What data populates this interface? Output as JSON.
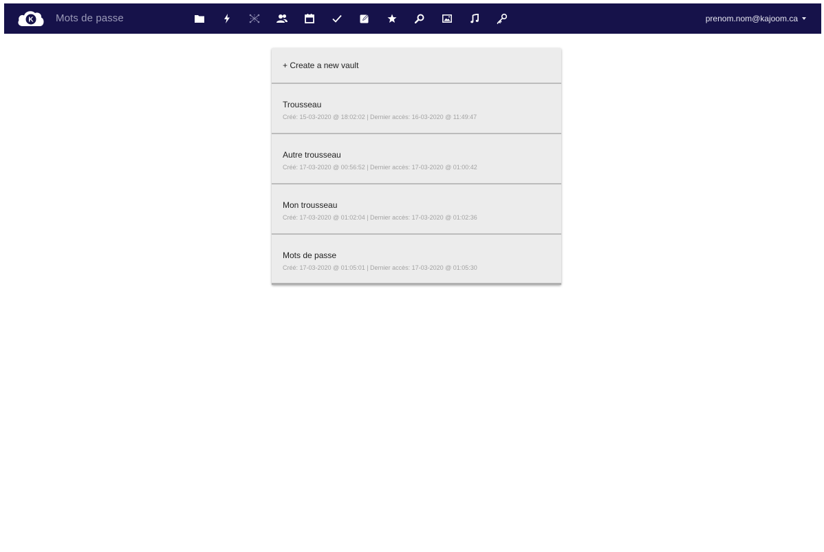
{
  "header": {
    "app_title": "Mots de passe",
    "logo_letter": "K",
    "user_email": "prenom.nom@kajoom.ca",
    "nav_icons": [
      "folder-icon",
      "lightning-icon",
      "network-icon",
      "contacts-icon",
      "calendar-icon",
      "checkmark-icon",
      "notes-icon",
      "star-icon",
      "search-icon",
      "image-icon",
      "music-icon",
      "key-icon"
    ]
  },
  "vaults": {
    "create_label": "+ Create a new vault",
    "items": [
      {
        "name": "Trousseau",
        "meta": "Créé: 15-03-2020 @ 18:02:02 | Dernier accès: 16-03-2020 @ 11:49:47"
      },
      {
        "name": "Autre trousseau",
        "meta": "Créé: 17-03-2020 @ 00:56:52 | Dernier accès: 17-03-2020 @ 01:00:42"
      },
      {
        "name": "Mon trousseau",
        "meta": "Créé: 17-03-2020 @ 01:02:04 | Dernier accès: 17-03-2020 @ 01:02:36"
      },
      {
        "name": "Mots de passe",
        "meta": "Créé: 17-03-2020 @ 01:05:01 | Dernier accès: 17-03-2020 @ 01:05:30"
      }
    ]
  },
  "colors": {
    "header_bg": "#16124a",
    "card_bg": "#ececec"
  }
}
